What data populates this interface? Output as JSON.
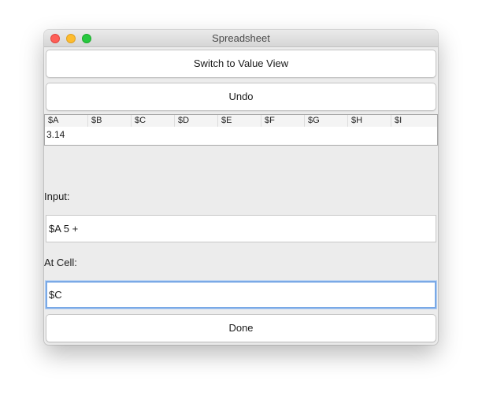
{
  "window": {
    "title": "Spreadsheet"
  },
  "toolbar": {
    "toggle_view_label": "Switch to Value View",
    "undo_label": "Undo"
  },
  "grid": {
    "columns": [
      "$A",
      "$B",
      "$C",
      "$D",
      "$E",
      "$F",
      "$G",
      "$H",
      "$I"
    ],
    "rows": [
      [
        "3.14",
        "",
        "",
        "",
        "",
        "",
        "",
        "",
        ""
      ]
    ]
  },
  "form": {
    "input_label": "Input:",
    "input_value": "$A 5 +",
    "cell_label": "At Cell:",
    "cell_value": "$C",
    "done_label": "Done"
  },
  "colors": {
    "close": "#fe5f57",
    "minimize": "#febc2e",
    "maximize": "#28c840",
    "focus_ring": "#7aa9e6"
  }
}
